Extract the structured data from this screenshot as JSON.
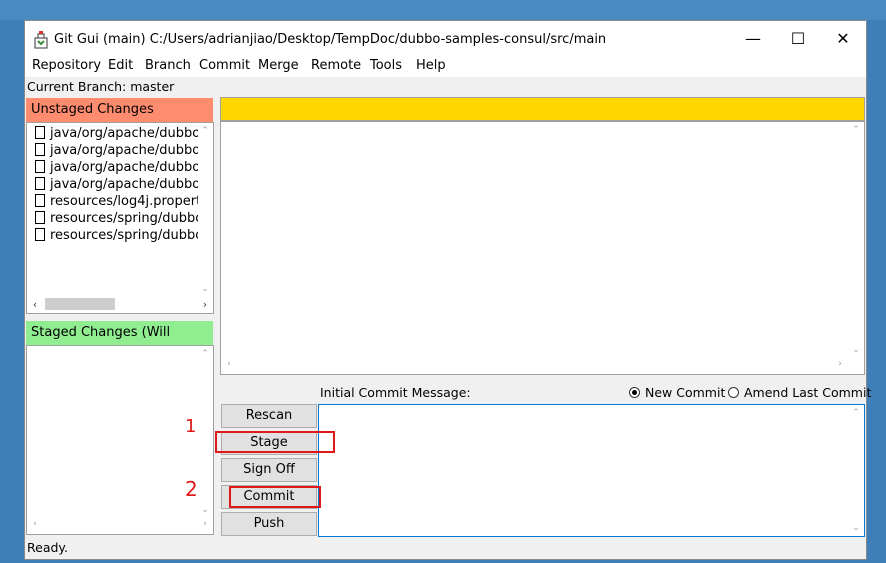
{
  "window": {
    "title": "Git Gui (main) C:/Users/adrianjiao/Desktop/TempDoc/dubbo-samples-consul/src/main",
    "minimize": "—",
    "maximize": "☐",
    "close": "✕"
  },
  "menu": {
    "items": [
      "Repository",
      "Edit",
      "Branch",
      "Commit",
      "Merge",
      "Remote",
      "Tools",
      "Help"
    ]
  },
  "branch_line": "Current Branch: master",
  "unstaged": {
    "header": "Unstaged Changes",
    "header_color": "#ff8c6e",
    "files": [
      "java/org/apache/dubbo,",
      "java/org/apache/dubbo,",
      "java/org/apache/dubbo,",
      "java/org/apache/dubbo,",
      "resources/log4j.properti",
      "resources/spring/dubbo",
      "resources/spring/dubbo"
    ]
  },
  "staged": {
    "header": "Staged Changes (Will Commit)",
    "header_color": "#90ee90"
  },
  "diff": {
    "header_color": "#ffd700"
  },
  "commit": {
    "message_label": "Initial Commit Message:",
    "new_commit_label": "New Commit",
    "amend_label": "Amend Last Commit",
    "selected_mode": "New Commit"
  },
  "buttons": {
    "rescan": "Rescan",
    "stage_changed": "Stage Changed",
    "sign_off": "Sign Off",
    "commit": "Commit",
    "push": "Push"
  },
  "annotations": {
    "mark1": "1",
    "mark2": "2",
    "color": "#e01818"
  },
  "status": "Ready."
}
